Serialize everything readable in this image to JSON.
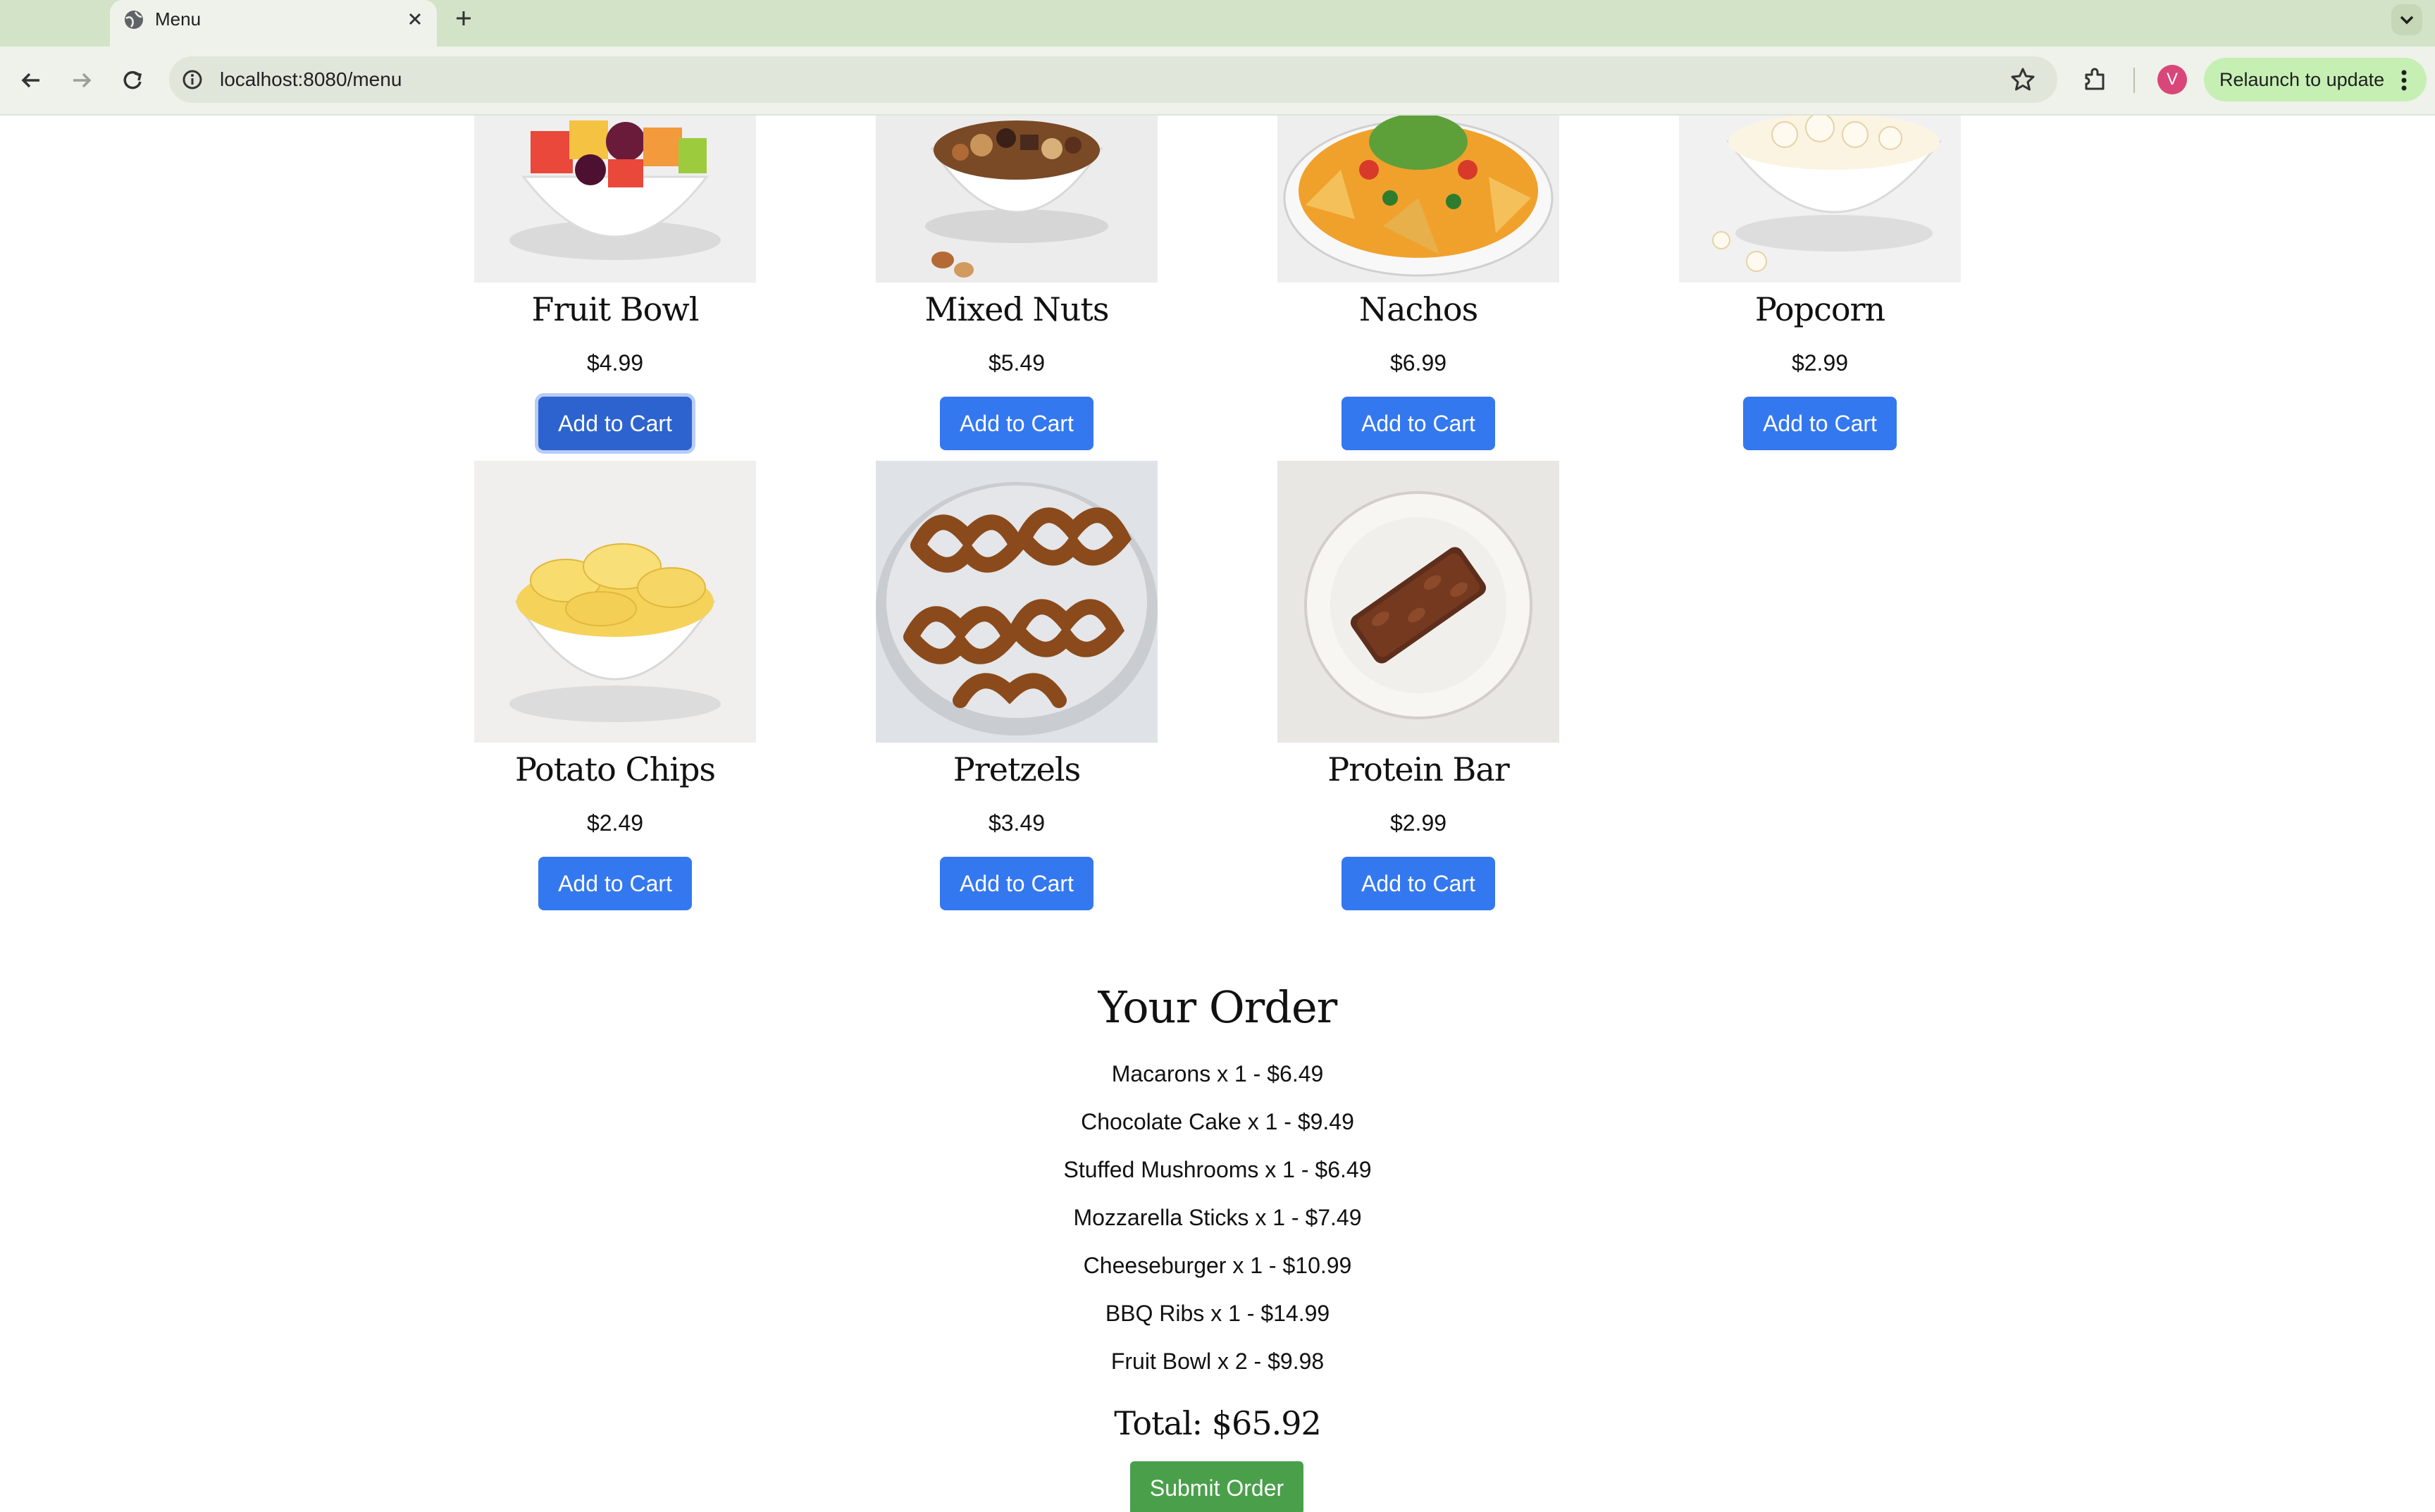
{
  "browser": {
    "tab_title": "Menu",
    "url": "localhost:8080/menu",
    "profile_initial": "V",
    "relaunch_label": "Relaunch to update",
    "icons": [
      "globe-icon",
      "close-icon",
      "plus-icon",
      "chevron-down-icon",
      "back-arrow-icon",
      "forward-arrow-icon",
      "reload-icon",
      "site-info-icon",
      "star-icon",
      "extensions-icon",
      "kebab-menu-icon"
    ]
  },
  "menu": {
    "items": [
      {
        "name": "Fruit Bowl",
        "price": "$4.99",
        "button": "Add to Cart"
      },
      {
        "name": "Mixed Nuts",
        "price": "$5.49",
        "button": "Add to Cart"
      },
      {
        "name": "Nachos",
        "price": "$6.99",
        "button": "Add to Cart"
      },
      {
        "name": "Popcorn",
        "price": "$2.99",
        "button": "Add to Cart"
      },
      {
        "name": "Potato Chips",
        "price": "$2.49",
        "button": "Add to Cart"
      },
      {
        "name": "Pretzels",
        "price": "$3.49",
        "button": "Add to Cart"
      },
      {
        "name": "Protein Bar",
        "price": "$2.99",
        "button": "Add to Cart"
      }
    ]
  },
  "order": {
    "heading": "Your Order",
    "lines": [
      "Macarons x 1 - $6.49",
      "Chocolate Cake x 1 - $9.49",
      "Stuffed Mushrooms x 1 - $6.49",
      "Mozzarella Sticks x 1 - $7.49",
      "Cheeseburger x 1 - $10.99",
      "BBQ Ribs x 1 - $14.99",
      "Fruit Bowl x 2 - $9.98"
    ],
    "total": "Total: $65.92",
    "submit_label": "Submit Order"
  },
  "colors": {
    "tabbar": "#d3e3c7",
    "add_to_cart": "#3478f0",
    "submit": "#4a9f4b",
    "avatar": "#d9477a"
  }
}
